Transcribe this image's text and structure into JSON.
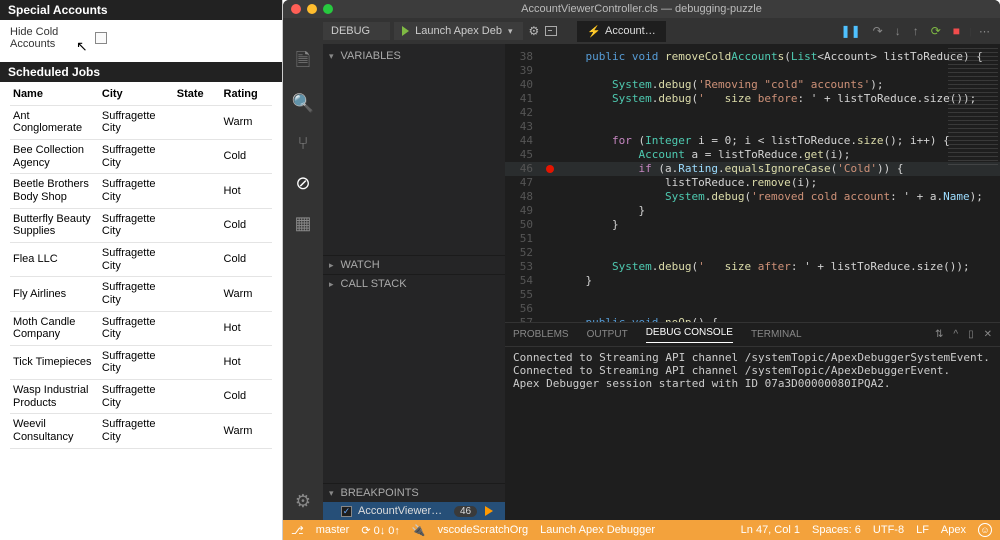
{
  "left": {
    "special_title": "Special Accounts",
    "hide_label": "Hide Cold Accounts",
    "scheduled_title": "Scheduled Jobs",
    "columns": {
      "name": "Name",
      "city": "City",
      "state": "State",
      "rating": "Rating"
    },
    "rows": [
      {
        "name": "Ant Conglomerate",
        "city": "Suffragette City",
        "state": "",
        "rating": "Warm"
      },
      {
        "name": "Bee Collection Agency",
        "city": "Suffragette City",
        "state": "",
        "rating": "Cold"
      },
      {
        "name": "Beetle Brothers Body Shop",
        "city": "Suffragette City",
        "state": "",
        "rating": "Hot"
      },
      {
        "name": "Butterfly Beauty Supplies",
        "city": "Suffragette City",
        "state": "",
        "rating": "Cold"
      },
      {
        "name": "Flea LLC",
        "city": "Suffragette City",
        "state": "",
        "rating": "Cold"
      },
      {
        "name": "Fly Airlines",
        "city": "Suffragette City",
        "state": "",
        "rating": "Warm"
      },
      {
        "name": "Moth Candle Company",
        "city": "Suffragette City",
        "state": "",
        "rating": "Hot"
      },
      {
        "name": "Tick Timepieces",
        "city": "Suffragette City",
        "state": "",
        "rating": "Hot"
      },
      {
        "name": "Wasp Industrial Products",
        "city": "Suffragette City",
        "state": "",
        "rating": "Cold"
      },
      {
        "name": "Weevil Consultancy",
        "city": "Suffragette City",
        "state": "",
        "rating": "Warm"
      }
    ]
  },
  "vsc": {
    "title": "AccountViewerController.cls — debugging-puzzle",
    "debug_label": "DEBUG",
    "launch_label": "Launch Apex Deb",
    "tab_label": "Account…",
    "sections": {
      "variables": "VARIABLES",
      "watch": "WATCH",
      "callstack": "CALL STACK",
      "breakpoints": "BREAKPOINTS"
    },
    "breakpoint_file": "AccountViewerController.cls   fo…",
    "breakpoint_badge": "46",
    "panel": {
      "tabs": {
        "problems": "PROBLEMS",
        "output": "OUTPUT",
        "debug": "DEBUG CONSOLE",
        "terminal": "TERMINAL"
      },
      "lines": [
        "Connected to Streaming API channel /systemTopic/ApexDebuggerSystemEvent.",
        "Connected to Streaming API channel /systemTopic/ApexDebuggerEvent.",
        "Apex Debugger session started with ID 07a3D00000080IPQA2."
      ]
    },
    "status": {
      "branch": "master",
      "sync": "⟳ 0↓ 0↑",
      "org": "vscodeScratchOrg",
      "task": "Launch Apex Debugger",
      "pos": "Ln 47, Col 1",
      "spaces": "Spaces: 6",
      "enc": "UTF-8",
      "eol": "LF",
      "lang": "Apex"
    },
    "code_start": 38,
    "code": [
      {
        "t": "    public void removeColdAccounts(List<Account> listToReduce) {",
        "c": [
          "kw:public",
          "kw:void",
          "fn:removeColdAccounts",
          "ty:List",
          "ty:Account"
        ]
      },
      {
        "t": ""
      },
      {
        "t": "        System.debug('Removing \"cold\" accounts');",
        "c": [
          "ty:System",
          "fn:debug",
          "st:'Removing \"cold\" accounts'"
        ]
      },
      {
        "t": "        System.debug('   size before: ' + listToReduce.size());",
        "c": [
          "ty:System",
          "fn:debug",
          "st:'   size before: '",
          "fn:size"
        ]
      },
      {
        "t": ""
      },
      {
        "t": ""
      },
      {
        "t": "        for (Integer i = 0; i < listToReduce.size(); i++) {",
        "c": [
          "pu:for",
          "ty:Integer",
          "fn:size"
        ]
      },
      {
        "t": "            Account a = listToReduce.get(i);",
        "c": [
          "ty:Account",
          "fn:get"
        ]
      },
      {
        "t": "            if (a.Rating.equalsIgnoreCase('Cold')) {",
        "c": [
          "pu:if",
          "pr:Rating",
          "fn:equalsIgnoreCase",
          "st:'Cold'"
        ],
        "hl": true
      },
      {
        "t": "                listToReduce.remove(i);",
        "c": [
          "fn:remove"
        ]
      },
      {
        "t": "                System.debug('removed cold account: ' + a.Name);",
        "c": [
          "ty:System",
          "fn:debug",
          "st:'removed cold account: '",
          "pr:Name"
        ]
      },
      {
        "t": "            }"
      },
      {
        "t": "        }"
      },
      {
        "t": ""
      },
      {
        "t": ""
      },
      {
        "t": "        System.debug('   size after: ' + listToReduce.size());",
        "c": [
          "ty:System",
          "fn:debug",
          "st:'   size after: '",
          "fn:size"
        ]
      },
      {
        "t": "    }"
      },
      {
        "t": ""
      },
      {
        "t": ""
      },
      {
        "t": "    public void noOp() {",
        "c": [
          "kw:public",
          "kw:void",
          "fn:noOp"
        ]
      }
    ],
    "breakpoint_line": 46
  }
}
